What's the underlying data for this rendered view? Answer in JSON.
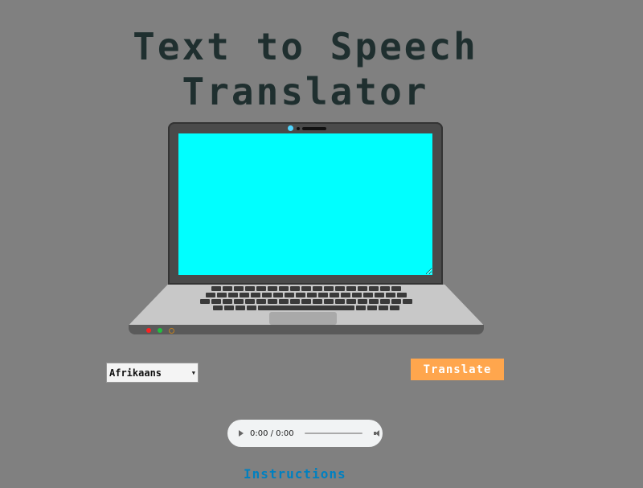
{
  "title": {
    "line1": "Text to Speech",
    "line2": "Translator"
  },
  "screen": {
    "value": ""
  },
  "language_select": {
    "selected": "Afrikaans"
  },
  "translate_button": {
    "label": "Translate"
  },
  "audio": {
    "time": "0:00 / 0:00"
  },
  "instructions_link": {
    "label": "Instructions"
  },
  "colors": {
    "background": "#808080",
    "title": "#1f2f2f",
    "screen": "#00ffff",
    "button": "#ffa64d",
    "link": "#0080c0"
  }
}
